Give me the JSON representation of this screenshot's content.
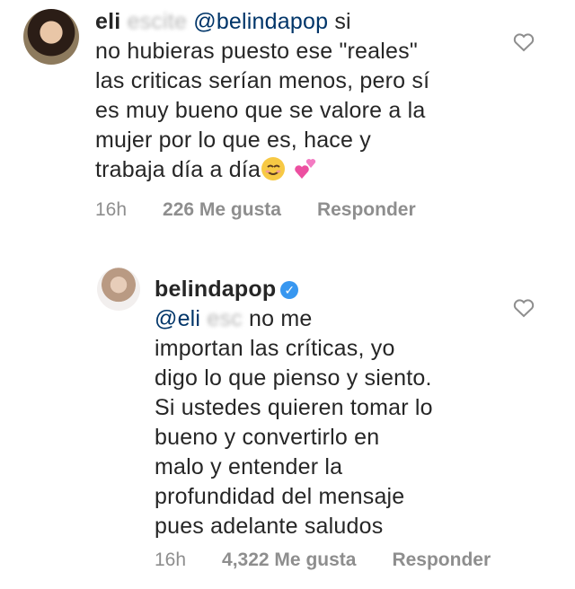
{
  "comments": [
    {
      "username": "eli",
      "username_hidden": "esc",
      "username_tail": "ite",
      "mention": "@belindapop",
      "text": "si\nno hubieras puesto ese \"reales\"\nlas criticas serían menos, pero sí\nes muy bueno que se valore a la\nmujer por lo que es, hace y\ntrabaja día a día",
      "time": "16h",
      "likes": "226 Me gusta",
      "reply_label": "Responder",
      "avatar_icon": "user-avatar-icon",
      "like_icon": "heart-outline-icon"
    },
    {
      "username": "belindapop",
      "verified": true,
      "mention_prefix": "@eli",
      "mention_hidden": "esc",
      "text": "no me\nimportan las críticas, yo\ndigo lo que pienso y siento.\nSi ustedes quieren tomar lo\nbueno y convertirlo en\nmalo y entender la\nprofundidad del mensaje\npues adelante saludos",
      "time": "16h",
      "likes": "4,322 Me gusta",
      "reply_label": "Responder",
      "avatar_icon": "user-avatar-icon",
      "like_icon": "heart-outline-icon"
    }
  ],
  "colors": {
    "text": "#262626",
    "muted": "#8e8e8e",
    "mention": "#003569",
    "verified_blue": "#3897f0",
    "heart_stroke": "#8e8e8e"
  }
}
